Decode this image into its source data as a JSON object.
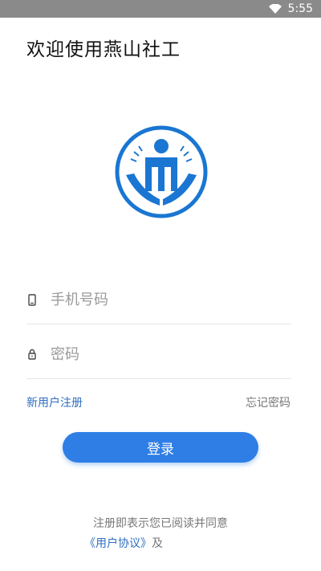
{
  "status_bar": {
    "time": "5:55",
    "icons": [
      "wifi-icon"
    ]
  },
  "welcome_title": "欢迎使用燕山社工",
  "form": {
    "phone_placeholder": "手机号码",
    "password_placeholder": "密码"
  },
  "links": {
    "register": "新用户注册",
    "forgot": "忘记密码"
  },
  "login_button": "登录",
  "agreement": {
    "text": "注册即表示您已阅读并同意",
    "user_agreement": "《用户协议》",
    "and": "及"
  },
  "colors": {
    "primary": "#2f7ee6",
    "link": "#2f6fc0",
    "status_bar": "#8a8a8a"
  }
}
